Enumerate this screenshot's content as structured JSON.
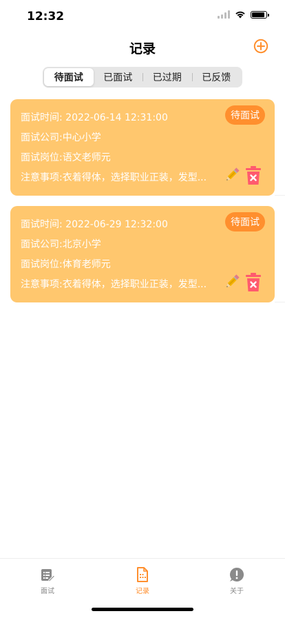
{
  "status_bar": {
    "time": "12:32"
  },
  "header": {
    "title": "记录"
  },
  "segments": [
    {
      "label": "待面试",
      "active": true
    },
    {
      "label": "已面试",
      "active": false
    },
    {
      "label": "已过期",
      "active": false
    },
    {
      "label": "已反馈",
      "active": false
    }
  ],
  "records": [
    {
      "time": "面试时间: 2022-06-14 12:31:00",
      "company": "面试公司:中心小学",
      "position": "面试岗位:语文老师元",
      "notes": "注意事项:衣着得体，选择职业正装，发型...",
      "status": "待面试"
    },
    {
      "time": "面试时间: 2022-06-29 12:32:00",
      "company": "面试公司:北京小学",
      "position": "面试岗位:体育老师元",
      "notes": "注意事项:衣着得体，选择职业正装，发型...",
      "status": "待面试"
    }
  ],
  "tabbar": {
    "items": [
      {
        "label": "面试",
        "icon": "interview-icon"
      },
      {
        "label": "记录",
        "icon": "record-icon"
      },
      {
        "label": "关于",
        "icon": "about-icon"
      }
    ]
  },
  "colors": {
    "accent": "#ff8f2e",
    "card_bg": "#ffc76e",
    "delete": "#ff5a6e",
    "tab_inactive": "#8a8a8a"
  }
}
